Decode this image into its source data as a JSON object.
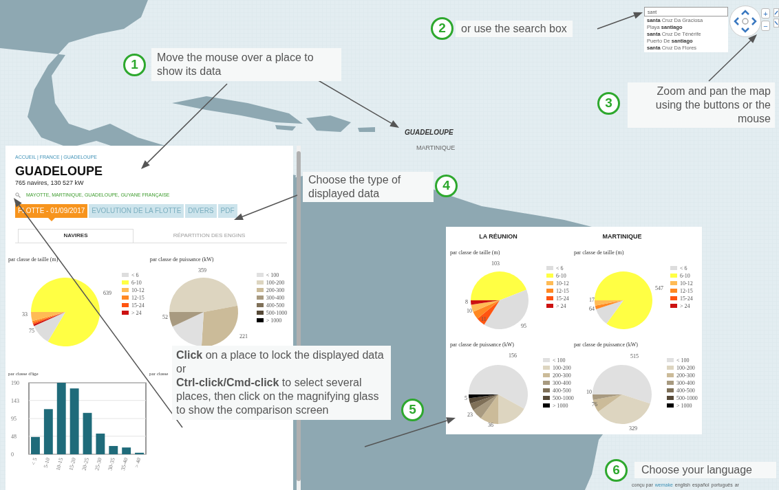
{
  "search": {
    "value": "sant",
    "suggestions": [
      "**santa** Cruz Da Graciosa",
      "Playa **santiago**",
      "**santa** Cruz De Ténérife",
      "Puerto De **santiago**",
      "**santa** Cruz Da Flores"
    ]
  },
  "zoom_buttons": [
    "+",
    "−"
  ],
  "map_labels": [
    {
      "text": "GUADELOUPE",
      "kind": "selected"
    },
    {
      "text": "MARTINIQUE",
      "kind": "plain"
    }
  ],
  "callouts": [
    {
      "number": "1",
      "text": "Move the mouse over a place to show its data"
    },
    {
      "number": "2",
      "text": "or use the search box"
    },
    {
      "number": "3",
      "text": "Zoom and pan the map using the buttons or the mouse"
    },
    {
      "number": "4",
      "text": "Choose the type of displayed data"
    },
    {
      "number": "5",
      "text": "**Click** on a place to lock the displayed data\nor\n**Ctrl-click/Cmd-click** to select several places, then click on the magnifying glass to show the comparison screen"
    },
    {
      "number": "6",
      "text": "Choose your language"
    }
  ],
  "panel": {
    "breadcrumb": "ACCUEIL | FRANCE | GUADELOUPE",
    "title": "GUADELOUPE",
    "summary": "765 navires, 130 527 kW",
    "selection": "MAYOTTE, MARTINIQUE, GUADELOUPE, GUYANE FRANÇAISE",
    "data_tabs": [
      {
        "label": "FLOTTE - 01/09/2017",
        "selected": true
      },
      {
        "label": "EVOLUTION DE LA FLOTTE",
        "selected": false
      },
      {
        "label": "DIVERS",
        "selected": false
      },
      {
        "label": "PDF",
        "selected": false
      }
    ],
    "sub_tabs": [
      {
        "label": "NAVIRES",
        "selected": true
      },
      {
        "label": "RÉPARTITION DES ENGINS",
        "selected": false
      }
    ],
    "size_chart": {
      "title": "par classe de taille (m)",
      "value_labels": [
        "639",
        "33",
        "75"
      ],
      "legend": [
        {
          "label": "< 6",
          "color": "#dddddd"
        },
        {
          "label": "6-10",
          "color": "#ffff44"
        },
        {
          "label": "10-12",
          "color": "#ffbb55"
        },
        {
          "label": "12-15",
          "color": "#ff8822"
        },
        {
          "label": "15-24",
          "color": "#ff5511"
        },
        {
          "label": "> 24",
          "color": "#cc1111"
        }
      ]
    },
    "power_chart": {
      "title": "par classe de puissance (kW)",
      "value_labels": [
        "359",
        "52",
        "221"
      ],
      "legend": [
        {
          "label": "< 100",
          "color": "#e0e0e0"
        },
        {
          "label": "100-200",
          "color": "#ddd5c0"
        },
        {
          "label": "200-300",
          "color": "#cbbb99"
        },
        {
          "label": "300-400",
          "color": "#a89a80"
        },
        {
          "label": "400-500",
          "color": "#7f7058"
        },
        {
          "label": "500-1000",
          "color": "#574a38"
        },
        {
          "label": "> 1000",
          "color": "#000000"
        }
      ]
    },
    "age_chart": {
      "title": "par classe d'âge",
      "chart_data": {
        "type": "bar",
        "categories": [
          "< 5",
          "5-10",
          "10-15",
          "15-20",
          "20-25",
          "25-30",
          "30-35",
          "35-40",
          "> 40"
        ],
        "series": [
          {
            "color": "#1f6b7a",
            "values": [
              46,
              120,
              190,
              175,
              110,
              55,
              22,
              18,
              4
            ]
          }
        ],
        "ylim": [
          0,
          190
        ],
        "yticks": [
          0,
          48,
          95,
          143,
          190
        ],
        "grid": true
      }
    },
    "hidden_chart_title": "par classe"
  },
  "comparison": [
    {
      "name": "LA RÉUNION",
      "size_chart": {
        "title": "par classe de taille (m)",
        "value_labels": [
          "103",
          "8",
          "10",
          "11",
          "95"
        ],
        "legend": [
          {
            "label": "< 6",
            "color": "#dddddd"
          },
          {
            "label": "6-10",
            "color": "#ffff44"
          },
          {
            "label": "10-12",
            "color": "#ffbb55"
          },
          {
            "label": "12-15",
            "color": "#ff8822"
          },
          {
            "label": "15-24",
            "color": "#ff5511"
          },
          {
            "label": "> 24",
            "color": "#cc1111"
          }
        ]
      },
      "power_chart": {
        "title": "par classe de puissance (kW)",
        "value_labels": [
          "156",
          "5",
          "23",
          "36"
        ],
        "legend": [
          {
            "label": "< 100",
            "color": "#e0e0e0"
          },
          {
            "label": "100-200",
            "color": "#ddd5c0"
          },
          {
            "label": "200-300",
            "color": "#cbbb99"
          },
          {
            "label": "300-400",
            "color": "#a89a80"
          },
          {
            "label": "400-500",
            "color": "#7f7058"
          },
          {
            "label": "500-1000",
            "color": "#574a38"
          },
          {
            "label": "> 1000",
            "color": "#000000"
          }
        ]
      }
    },
    {
      "name": "MARTINIQUE",
      "size_chart": {
        "title": "par classe de taille (m)",
        "value_labels": [
          "547",
          "17",
          "64"
        ],
        "legend": [
          {
            "label": "< 6",
            "color": "#dddddd"
          },
          {
            "label": "6-10",
            "color": "#ffff44"
          },
          {
            "label": "10-12",
            "color": "#ffbb55"
          },
          {
            "label": "12-15",
            "color": "#ff8822"
          },
          {
            "label": "15-24",
            "color": "#ff5511"
          },
          {
            "label": "> 24",
            "color": "#cc1111"
          }
        ]
      },
      "power_chart": {
        "title": "par classe de puissance (kW)",
        "value_labels": [
          "515",
          "10",
          "76",
          "329"
        ],
        "legend": [
          {
            "label": "< 100",
            "color": "#e0e0e0"
          },
          {
            "label": "100-200",
            "color": "#ddd5c0"
          },
          {
            "label": "200-300",
            "color": "#cbbb99"
          },
          {
            "label": "300-400",
            "color": "#a89a80"
          },
          {
            "label": "400-500",
            "color": "#7f7058"
          },
          {
            "label": "500-1000",
            "color": "#574a38"
          },
          {
            "label": "> 1000",
            "color": "#000000"
          }
        ]
      }
    }
  ],
  "footer": {
    "credit": "conçu par",
    "credit_link": "wemake",
    "languages": [
      "english",
      "español",
      "português",
      "ar"
    ]
  }
}
